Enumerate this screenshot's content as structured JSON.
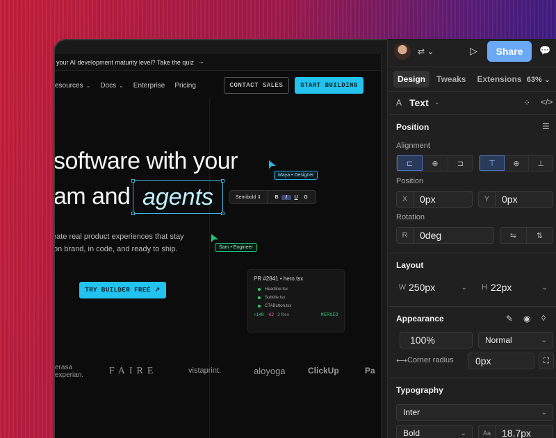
{
  "announcement": {
    "text": "your AI development maturity level? Take the quiz",
    "arrow": "→"
  },
  "nav": {
    "links": [
      {
        "label": "esources",
        "has_chevron": true
      },
      {
        "label": "Docs",
        "has_chevron": true
      },
      {
        "label": "Enterprise",
        "has_chevron": false
      },
      {
        "label": "Pricing",
        "has_chevron": false
      }
    ],
    "contact_label": "CONTACT SALES",
    "start_label": "START BUILDING"
  },
  "hero": {
    "line1": "software with your",
    "line2_prefix": "am and",
    "line2_highlight": "agents",
    "subtitle_line1": "eate real product experiences that stay",
    "subtitle_line2": "on brand, in code, and ready to ship.",
    "cta_label": "TRY BUILDER FREE ↗"
  },
  "format_bar": {
    "weight": "Semibold ⇕",
    "buttons": [
      "B",
      "I",
      "U",
      "G"
    ]
  },
  "cursors": {
    "maya": "Maya • Designer",
    "sam": "Sam • Engineer"
  },
  "pr_card": {
    "title": "PR #2841 • hero.tsx",
    "files": [
      "Headline.tsx",
      "Subtitle.tsx",
      "CTAButton.tsx"
    ],
    "additions": "+148",
    "deletions": "-62",
    "file_count": "3 files",
    "status": "MERGED"
  },
  "logos": [
    "erasa",
    "experian.",
    "FAIRE",
    "vistaprint.",
    "aloyoga",
    "ClickUp",
    "Pa"
  ],
  "panel": {
    "share_label": "Share",
    "tabs": [
      "Design",
      "Tweaks",
      "Extensions"
    ],
    "zoom": "63% ⌄",
    "element_type": "Text",
    "position_title": "Position",
    "alignment_label": "Alignment",
    "position_label": "Position",
    "x_label": "X",
    "x_value": "0px",
    "y_label": "Y",
    "y_value": "0px",
    "rotation_label": "Rotation",
    "r_label": "R",
    "rotation_value": "0deg",
    "layout_title": "Layout",
    "w_label": "W",
    "w_value": "250px",
    "h_label": "H",
    "h_value": "22px",
    "appearance_title": "Appearance",
    "opacity_value": "100%",
    "blend_value": "Normal",
    "corner_label": "Corner radius",
    "corner_value": "0px",
    "typography_title": "Typography",
    "font_value": "Inter",
    "weight_value": "Bold",
    "size_value": "18.7px"
  },
  "colors": {
    "accent_cyan": "#22c3ee",
    "share_blue": "#6aa8f8",
    "merged_green": "#2dd36f"
  }
}
